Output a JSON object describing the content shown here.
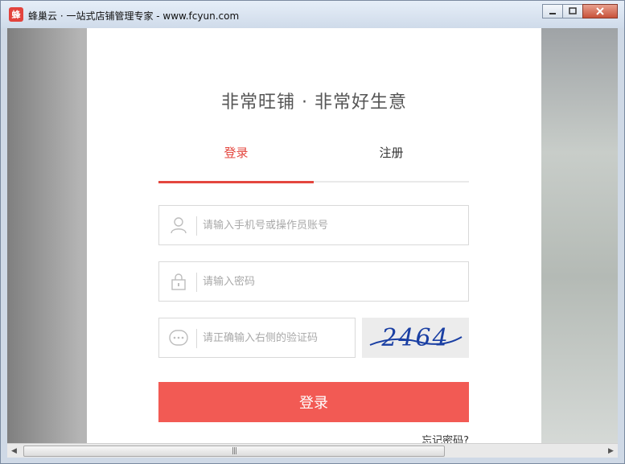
{
  "window": {
    "title": "蜂巢云 · 一站式店铺管理专家 - www.fcyun.com",
    "icon": "app-logo-icon",
    "controls": [
      "minimize-icon",
      "maximize-icon",
      "close-icon"
    ]
  },
  "login": {
    "headline": "非常旺铺 · 非常好生意",
    "tabs": [
      {
        "label": "登录",
        "active": true
      },
      {
        "label": "注册",
        "active": false
      }
    ],
    "fields": {
      "account": {
        "placeholder": "请输入手机号或操作员账号",
        "value": "",
        "icon": "user-icon"
      },
      "password": {
        "placeholder": "请输入密码",
        "value": "",
        "icon": "lock-icon"
      },
      "captcha": {
        "placeholder": "请正确输入右侧的验证码",
        "value": "",
        "icon": "chat-dots-icon"
      }
    },
    "captcha_code": "2464",
    "submit_label": "登录",
    "forgot_label": "忘记密码?"
  },
  "colors": {
    "accent": "#f25a54",
    "active_tab": "#e4463e",
    "captcha_ink": "#1a3fa3"
  }
}
